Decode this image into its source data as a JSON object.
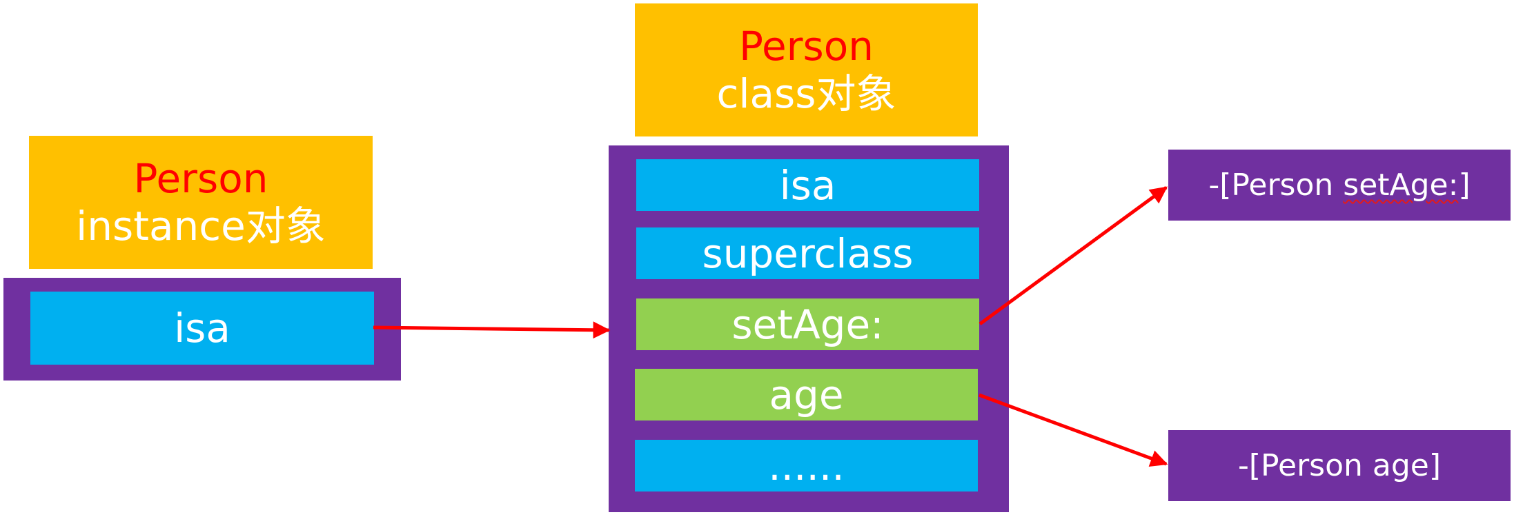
{
  "colors": {
    "header_bg": "#FFC000",
    "header_name": "#FF0000",
    "header_kind": "#FFFFFF",
    "container": "#7030A0",
    "slot_blue": "#00B0F0",
    "slot_green": "#92D050",
    "arrow": "#FF0000"
  },
  "instance": {
    "name": "Person",
    "kind": "instance对象",
    "slots": [
      {
        "label": "isa",
        "color": "#00B0F0"
      }
    ]
  },
  "class_object": {
    "name": "Person",
    "kind": "class对象",
    "slots": [
      {
        "label": "isa",
        "color": "#00B0F0"
      },
      {
        "label": "superclass",
        "color": "#00B0F0"
      },
      {
        "label": "setAge:",
        "color": "#92D050"
      },
      {
        "label": "age",
        "color": "#92D050"
      },
      {
        "label": "......",
        "color": "#00B0F0"
      }
    ]
  },
  "methods": [
    {
      "prefix": "-[Person ",
      "selector": "setAge:",
      "suffix": "]"
    },
    {
      "prefix": "-[Person age]",
      "selector": "",
      "suffix": ""
    }
  ]
}
